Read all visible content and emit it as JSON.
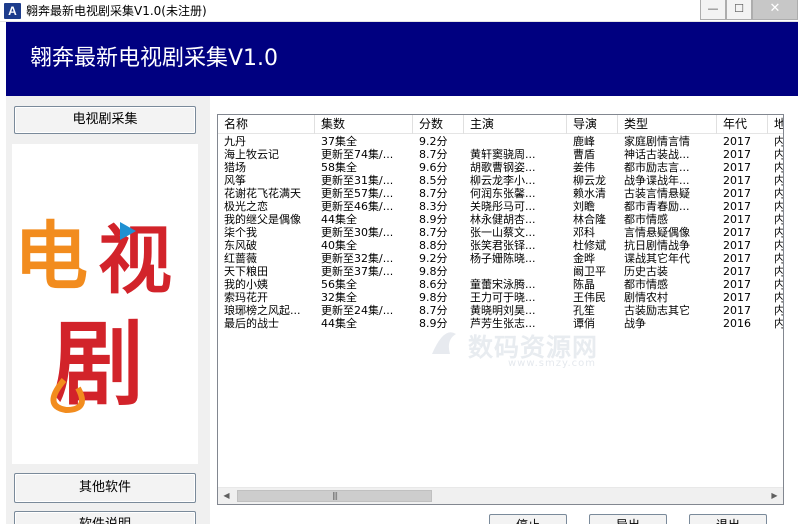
{
  "window": {
    "title": "翱奔最新电视剧采集V1.0(未注册)",
    "app_icon_text": "A",
    "minimize_glyph": "—",
    "maximize_glyph": "☐",
    "close_glyph": "✕"
  },
  "banner": {
    "title": "翱奔最新电视剧采集V1.0",
    "bg_color": "#000080"
  },
  "left_panel": {
    "top_button_label": "电视剧采集",
    "other_button_label": "其他软件",
    "about_button_label": "软件说明",
    "logo_text": [
      "电",
      "视",
      "剧"
    ],
    "logo_colors": {
      "orange": "#f28c1e",
      "red": "#d2232a",
      "blue": "#1e90d2"
    }
  },
  "list": {
    "columns": [
      "名称",
      "集数",
      "分数",
      "主演",
      "导演",
      "类型",
      "年代",
      "地"
    ],
    "rows": [
      [
        "九丹",
        "37集全",
        "9.2分",
        "",
        "鹿峰",
        "家庭剧情言情",
        "2017",
        "内"
      ],
      [
        "海上牧云记",
        "更新至74集/...",
        "8.7分",
        "黄轩窦骁周...",
        "曹盾",
        "神话古装战...",
        "2017",
        "内"
      ],
      [
        "猎场",
        "58集全",
        "9.6分",
        "胡歌曹钢姿...",
        "姜伟",
        "都市励志言...",
        "2017",
        "内"
      ],
      [
        "风筝",
        "更新至31集/...",
        "8.5分",
        "柳云龙李小...",
        "柳云龙",
        "战争谍战年...",
        "2017",
        "内"
      ],
      [
        "花谢花飞花满天",
        "更新至57集/...",
        "8.7分",
        "何润东张馨...",
        "赖水清",
        "古装言情悬疑",
        "2017",
        "内"
      ],
      [
        "极光之恋",
        "更新至46集/...",
        "8.3分",
        "关晓彤马可...",
        "刘瞻",
        "都市青春励...",
        "2017",
        "内"
      ],
      [
        "我的继父是偶像",
        "44集全",
        "8.9分",
        "林永健胡杏...",
        "林合隆",
        "都市情感",
        "2017",
        "内"
      ],
      [
        "柒个我",
        "更新至30集/...",
        "8.7分",
        "张一山蔡文...",
        "邓科",
        "言情悬疑偶像",
        "2017",
        "内"
      ],
      [
        "东风破",
        "40集全",
        "8.8分",
        "张笑君张铎...",
        "杜修斌",
        "抗日剧情战争",
        "2017",
        "内"
      ],
      [
        "红蔷薇",
        "更新至32集/...",
        "9.2分",
        "杨子姗陈晓...",
        "金晔",
        "谍战其它年代",
        "2017",
        "内"
      ],
      [
        "天下粮田",
        "更新至37集/...",
        "9.8分",
        "",
        "阚卫平",
        "历史古装",
        "2017",
        "内"
      ],
      [
        "我的小姨",
        "56集全",
        "8.6分",
        "童蕾宋泳腾...",
        "陈晶",
        "都市情感",
        "2017",
        "内"
      ],
      [
        "索玛花开",
        "32集全",
        "9.8分",
        "王力可于晓...",
        "王伟民",
        "剧情农村",
        "2017",
        "内"
      ],
      [
        "琅琊榜之风起...",
        "更新至24集/...",
        "8.7分",
        "黄晓明刘昊...",
        "孔笙",
        "古装励志其它",
        "2017",
        "内"
      ],
      [
        "最后的战士",
        "44集全",
        "8.9分",
        "芦芳生张志...",
        "谭俏",
        "战争",
        "2016",
        "内"
      ]
    ],
    "scroll_left_glyph": "◀",
    "scroll_right_glyph": "▶",
    "scroll_thumb_grip": "|||"
  },
  "bottom_buttons": [
    "停止",
    "导出",
    "退出"
  ],
  "watermark": {
    "text": "数码资源网",
    "url": "www.smzy.com"
  }
}
